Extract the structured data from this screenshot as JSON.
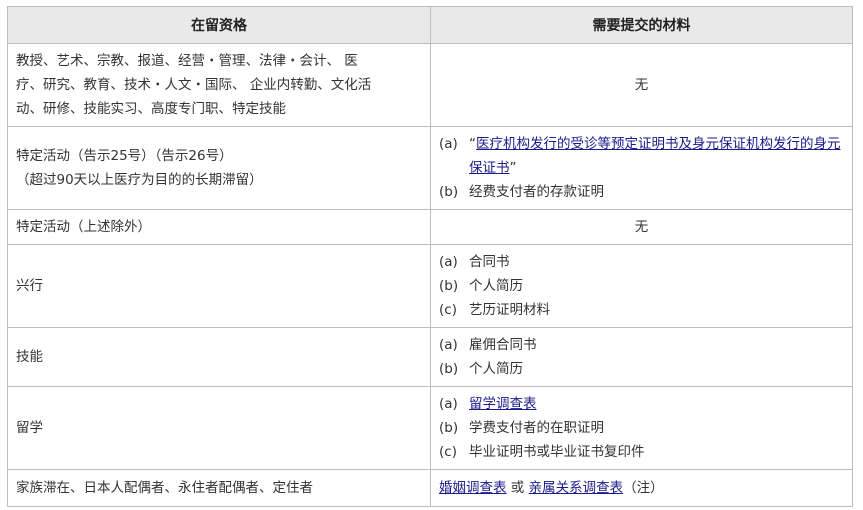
{
  "table": {
    "headers": [
      "在留资格",
      "需要提交的材料"
    ],
    "rows": [
      {
        "status_lines": [
          "教授、艺术、宗教、报道、经营・管理、法律・会计、 医",
          "疗、研究、教育、技术・人文・国际、 企业内转勤、文化活",
          "动、研修、技能实习、高度专门职、特定技能"
        ],
        "materials_plain": "无"
      },
      {
        "status_lines": [
          "特定活动（告示25号）（告示26号）",
          "（超过90天以上医疗为目的的长期滞留）"
        ],
        "materials": [
          {
            "mark": "(a)",
            "open_quote": "“",
            "link": "医疗机构发行的受诊等预定证明书及身元保证机构发行的身元保证书",
            "close_quote": "”"
          },
          {
            "mark": "(b)",
            "text": "经费支付者的存款证明"
          }
        ]
      },
      {
        "status_lines": [
          "特定活动（上述除外）"
        ],
        "materials_plain": "无"
      },
      {
        "status_lines": [
          "兴行"
        ],
        "materials": [
          {
            "mark": "(a)",
            "text": "合同书"
          },
          {
            "mark": "(b)",
            "text": "个人简历"
          },
          {
            "mark": "(c)",
            "text": "艺历证明材料"
          }
        ]
      },
      {
        "status_lines": [
          "技能"
        ],
        "materials": [
          {
            "mark": "(a)",
            "text": "雇佣合同书"
          },
          {
            "mark": "(b)",
            "text": "个人简历"
          }
        ]
      },
      {
        "status_lines": [
          "留学"
        ],
        "materials": [
          {
            "mark": "(a)",
            "link": "留学调查表"
          },
          {
            "mark": "(b)",
            "text": "学费支付者的在职证明"
          },
          {
            "mark": "(c)",
            "text": "毕业证明书或毕业证书复印件"
          }
        ]
      },
      {
        "status_lines": [
          "家族滞在、日本人配偶者、永住者配偶者、定住者"
        ],
        "materials_inline": {
          "link1": "婚姻调查表",
          "or": " 或 ",
          "link2": "亲属关系调查表",
          "note": "（注）"
        }
      }
    ]
  }
}
